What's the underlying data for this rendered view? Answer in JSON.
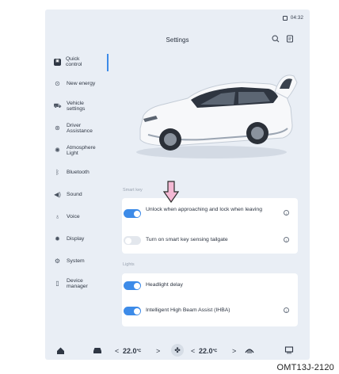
{
  "status": {
    "time": "04:32"
  },
  "header": {
    "title": "Settings",
    "search_icon": "search-icon",
    "menu_icon": "note-icon"
  },
  "sidebar": {
    "items": [
      {
        "label": "Quick control",
        "icon": "quick-control-icon",
        "active": true
      },
      {
        "label": "New energy",
        "icon": "energy-icon"
      },
      {
        "label": "Vehicle settings",
        "icon": "car-icon"
      },
      {
        "label": "Driver Assistance",
        "icon": "steering-wheel-icon"
      },
      {
        "label": "Atmosphere Light",
        "icon": "sun-icon"
      },
      {
        "label": "Bluetooth",
        "icon": "bluetooth-icon"
      },
      {
        "label": "Sound",
        "icon": "speaker-icon"
      },
      {
        "label": "Voice",
        "icon": "microphone-icon"
      },
      {
        "label": "Display",
        "icon": "brightness-icon"
      },
      {
        "label": "System",
        "icon": "gear-icon"
      },
      {
        "label": "Device manager",
        "icon": "device-icon"
      }
    ]
  },
  "smart_key": {
    "section_label": "Smart key",
    "rows": [
      {
        "label": "Unlock when approaching and lock when leaving",
        "on": true,
        "info": true
      },
      {
        "label": "Turn on smart key sensing tailgate",
        "on": false,
        "info": true
      }
    ]
  },
  "lights": {
    "section_label": "Lights",
    "rows": [
      {
        "label": "Headlight delay",
        "on": true,
        "info": false
      },
      {
        "label": "Intelligent High Beam Assist (IHBA)",
        "on": true,
        "info": true
      }
    ]
  },
  "bottom_bar": {
    "left_temp": "22.0",
    "right_temp": "22.0",
    "unit": "℃",
    "left_chevron": "<",
    "right_chevron": ">"
  },
  "figure_code": "OMT13J-2120",
  "colors": {
    "accent": "#3d8be8",
    "screen_bg": "#e9eef5",
    "arrow": "#f4b9d4"
  }
}
